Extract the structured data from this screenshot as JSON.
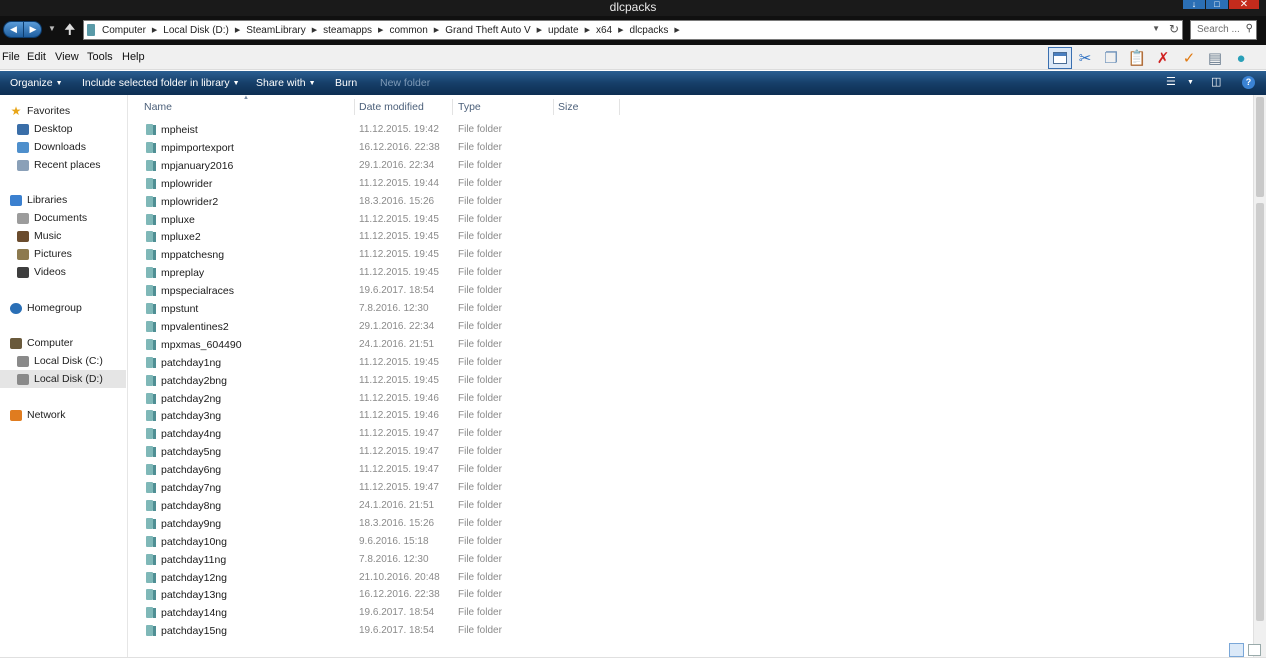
{
  "window": {
    "title": "dlcpacks"
  },
  "address": {
    "crumbs": [
      "Computer",
      "Local Disk (D:)",
      "SteamLibrary",
      "steamapps",
      "common",
      "Grand Theft Auto V",
      "update",
      "x64",
      "dlcpacks"
    ],
    "search_placeholder": "Search ..."
  },
  "menu": {
    "items": [
      "File",
      "Edit",
      "View",
      "Tools",
      "Help"
    ]
  },
  "toolbar_icons": [
    "layout-icon",
    "cut-icon",
    "copy-icon",
    "paste-icon",
    "delete-icon",
    "checkmark-icon",
    "rename-icon",
    "globe-icon"
  ],
  "command_bar": {
    "organize": "Organize",
    "include": "Include selected folder in library",
    "share": "Share with",
    "burn": "Burn",
    "new_folder": "New folder"
  },
  "nav": {
    "favorites": "Favorites",
    "desktop": "Desktop",
    "downloads": "Downloads",
    "recent": "Recent places",
    "libraries": "Libraries",
    "documents": "Documents",
    "music": "Music",
    "pictures": "Pictures",
    "videos": "Videos",
    "homegroup": "Homegroup",
    "computer": "Computer",
    "disk_c": "Local Disk (C:)",
    "disk_d": "Local Disk (D:)",
    "network": "Network"
  },
  "columns": {
    "name": "Name",
    "date": "Date modified",
    "type": "Type",
    "size": "Size"
  },
  "files": [
    {
      "name": "mpheist",
      "date": "11.12.2015. 19:42",
      "type": "File folder"
    },
    {
      "name": "mpimportexport",
      "date": "16.12.2016. 22:38",
      "type": "File folder"
    },
    {
      "name": "mpjanuary2016",
      "date": "29.1.2016. 22:34",
      "type": "File folder"
    },
    {
      "name": "mplowrider",
      "date": "11.12.2015. 19:44",
      "type": "File folder"
    },
    {
      "name": "mplowrider2",
      "date": "18.3.2016. 15:26",
      "type": "File folder"
    },
    {
      "name": "mpluxe",
      "date": "11.12.2015. 19:45",
      "type": "File folder"
    },
    {
      "name": "mpluxe2",
      "date": "11.12.2015. 19:45",
      "type": "File folder"
    },
    {
      "name": "mppatchesng",
      "date": "11.12.2015. 19:45",
      "type": "File folder"
    },
    {
      "name": "mpreplay",
      "date": "11.12.2015. 19:45",
      "type": "File folder"
    },
    {
      "name": "mpspecialraces",
      "date": "19.6.2017. 18:54",
      "type": "File folder"
    },
    {
      "name": "mpstunt",
      "date": "7.8.2016. 12:30",
      "type": "File folder"
    },
    {
      "name": "mpvalentines2",
      "date": "29.1.2016. 22:34",
      "type": "File folder"
    },
    {
      "name": "mpxmas_604490",
      "date": "24.1.2016. 21:51",
      "type": "File folder"
    },
    {
      "name": "patchday1ng",
      "date": "11.12.2015. 19:45",
      "type": "File folder"
    },
    {
      "name": "patchday2bng",
      "date": "11.12.2015. 19:45",
      "type": "File folder"
    },
    {
      "name": "patchday2ng",
      "date": "11.12.2015. 19:46",
      "type": "File folder"
    },
    {
      "name": "patchday3ng",
      "date": "11.12.2015. 19:46",
      "type": "File folder"
    },
    {
      "name": "patchday4ng",
      "date": "11.12.2015. 19:47",
      "type": "File folder"
    },
    {
      "name": "patchday5ng",
      "date": "11.12.2015. 19:47",
      "type": "File folder"
    },
    {
      "name": "patchday6ng",
      "date": "11.12.2015. 19:47",
      "type": "File folder"
    },
    {
      "name": "patchday7ng",
      "date": "11.12.2015. 19:47",
      "type": "File folder"
    },
    {
      "name": "patchday8ng",
      "date": "24.1.2016. 21:51",
      "type": "File folder"
    },
    {
      "name": "patchday9ng",
      "date": "18.3.2016. 15:26",
      "type": "File folder"
    },
    {
      "name": "patchday10ng",
      "date": "9.6.2016. 15:18",
      "type": "File folder"
    },
    {
      "name": "patchday11ng",
      "date": "7.8.2016. 12:30",
      "type": "File folder"
    },
    {
      "name": "patchday12ng",
      "date": "21.10.2016. 20:48",
      "type": "File folder"
    },
    {
      "name": "patchday13ng",
      "date": "16.12.2016. 22:38",
      "type": "File folder"
    },
    {
      "name": "patchday14ng",
      "date": "19.6.2017. 18:54",
      "type": "File folder"
    },
    {
      "name": "patchday15ng",
      "date": "19.6.2017. 18:54",
      "type": "File folder"
    }
  ]
}
